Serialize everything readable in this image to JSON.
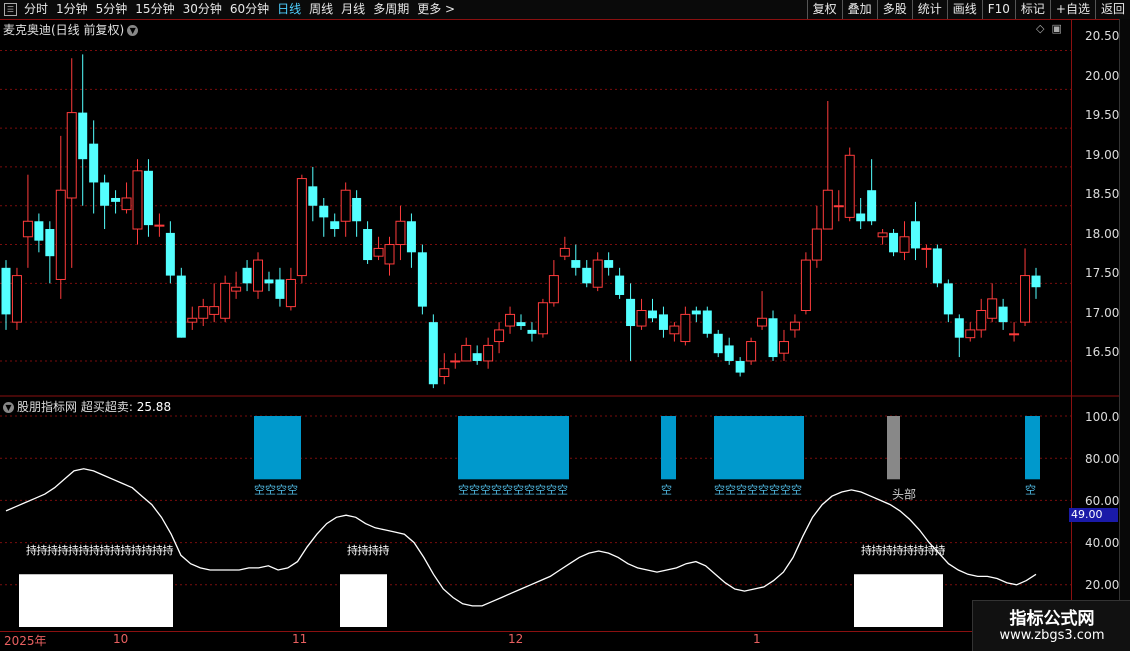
{
  "toolbar": {
    "periods": [
      "分时",
      "1分钟",
      "5分钟",
      "15分钟",
      "30分钟",
      "60分钟",
      "日线",
      "周线",
      "月线",
      "多周期",
      "更多 >"
    ],
    "active_period": "日线",
    "tools": [
      "复权",
      "叠加",
      "多股",
      "统计",
      "画线",
      "F10",
      "标记",
      "+自选",
      "返回"
    ]
  },
  "main_panel": {
    "title": "麦克奥迪(日线 前复权)",
    "price_axis": [
      "20.50",
      "20.00",
      "19.50",
      "19.00",
      "18.50",
      "18.00",
      "17.50",
      "17.00",
      "16.50"
    ]
  },
  "indicator_panel": {
    "name": "股朋指标网",
    "series_label": "超买超卖:",
    "series_value": "25.88",
    "axis": [
      "100.0",
      "80.00",
      "60.00",
      "40.00",
      "20.00"
    ],
    "current_tag": "49.00",
    "kong_label": "空",
    "chi_label": "持",
    "head_label": "头部"
  },
  "date_axis": [
    "2025年",
    "10",
    "11",
    "12",
    "1"
  ],
  "watermark": {
    "line1": "指标公式网",
    "line2": "www.zbgs3.com"
  },
  "colors": {
    "up": "#ff3c3c",
    "down": "#54ffff",
    "grid": "#7a0d0d",
    "bear_block": "#0099cc",
    "head_block": "#888888",
    "oscillator": "#ffffff"
  },
  "chart_data": {
    "type": "candlestick",
    "ylim": [
      16.1,
      20.7
    ],
    "candles": [
      [
        17.7,
        17.1,
        17.8,
        16.9
      ],
      [
        17.0,
        17.6,
        17.7,
        16.9
      ],
      [
        18.1,
        18.3,
        18.9,
        17.7
      ],
      [
        18.3,
        18.05,
        18.4,
        17.9
      ],
      [
        18.2,
        17.85,
        18.3,
        17.5
      ],
      [
        17.55,
        18.7,
        19.4,
        17.3
      ],
      [
        18.6,
        19.7,
        20.4,
        17.7
      ],
      [
        19.7,
        19.1,
        20.45,
        18.5
      ],
      [
        19.3,
        18.8,
        19.6,
        18.4
      ],
      [
        18.8,
        18.5,
        18.9,
        18.2
      ],
      [
        18.6,
        18.55,
        18.7,
        18.4
      ],
      [
        18.45,
        18.6,
        18.8,
        18.4
      ],
      [
        18.2,
        18.95,
        19.1,
        18.0
      ],
      [
        18.95,
        18.25,
        19.1,
        18.1
      ],
      [
        18.25,
        18.25,
        18.4,
        18.1
      ],
      [
        18.15,
        17.6,
        18.3,
        17.5
      ],
      [
        17.6,
        16.8,
        17.7,
        16.8
      ],
      [
        17.0,
        17.05,
        17.2,
        16.9
      ],
      [
        17.05,
        17.2,
        17.3,
        16.95
      ],
      [
        17.1,
        17.2,
        17.5,
        17.0
      ],
      [
        17.05,
        17.5,
        17.6,
        17.0
      ],
      [
        17.4,
        17.45,
        17.65,
        17.3
      ],
      [
        17.7,
        17.5,
        17.8,
        17.4
      ],
      [
        17.4,
        17.8,
        17.9,
        17.3
      ],
      [
        17.55,
        17.5,
        17.65,
        17.4
      ],
      [
        17.55,
        17.3,
        17.7,
        17.2
      ],
      [
        17.2,
        17.55,
        17.7,
        17.15
      ],
      [
        17.6,
        18.85,
        18.9,
        17.5
      ],
      [
        18.75,
        18.5,
        19.0,
        18.3
      ],
      [
        18.5,
        18.35,
        18.6,
        18.1
      ],
      [
        18.3,
        18.2,
        18.4,
        18.1
      ],
      [
        18.3,
        18.7,
        18.8,
        18.1
      ],
      [
        18.6,
        18.3,
        18.7,
        18.1
      ],
      [
        18.2,
        17.8,
        18.3,
        17.75
      ],
      [
        17.85,
        17.95,
        18.1,
        17.8
      ],
      [
        17.75,
        18.0,
        18.1,
        17.6
      ],
      [
        18.0,
        18.3,
        18.5,
        17.8
      ],
      [
        18.3,
        17.9,
        18.4,
        17.7
      ],
      [
        17.9,
        17.2,
        18.0,
        17.1
      ],
      [
        17.0,
        16.2,
        17.1,
        16.15
      ],
      [
        16.3,
        16.4,
        16.6,
        16.2
      ],
      [
        16.5,
        16.5,
        16.6,
        16.4
      ],
      [
        16.5,
        16.7,
        16.8,
        16.5
      ],
      [
        16.6,
        16.5,
        16.7,
        16.45
      ],
      [
        16.5,
        16.7,
        16.8,
        16.4
      ],
      [
        16.75,
        16.9,
        17.0,
        16.6
      ],
      [
        16.95,
        17.1,
        17.2,
        16.85
      ],
      [
        17.0,
        16.95,
        17.1,
        16.9
      ],
      [
        16.9,
        16.85,
        17.0,
        16.75
      ],
      [
        16.85,
        17.25,
        17.3,
        16.8
      ],
      [
        17.25,
        17.6,
        17.8,
        17.2
      ],
      [
        17.85,
        17.95,
        18.1,
        17.8
      ],
      [
        17.8,
        17.7,
        18.0,
        17.6
      ],
      [
        17.7,
        17.5,
        17.8,
        17.45
      ],
      [
        17.45,
        17.8,
        17.9,
        17.4
      ],
      [
        17.8,
        17.7,
        17.9,
        17.6
      ],
      [
        17.6,
        17.35,
        17.7,
        17.3
      ],
      [
        17.3,
        16.95,
        17.5,
        16.5
      ],
      [
        16.95,
        17.15,
        17.3,
        16.9
      ],
      [
        17.15,
        17.05,
        17.3,
        17.0
      ],
      [
        17.1,
        16.9,
        17.2,
        16.8
      ],
      [
        16.85,
        16.95,
        17.0,
        16.75
      ],
      [
        16.75,
        17.1,
        17.2,
        16.7
      ],
      [
        17.15,
        17.1,
        17.2,
        17.0
      ],
      [
        17.15,
        16.85,
        17.2,
        16.8
      ],
      [
        16.85,
        16.6,
        16.9,
        16.55
      ],
      [
        16.7,
        16.5,
        16.8,
        16.45
      ],
      [
        16.5,
        16.35,
        16.55,
        16.3
      ],
      [
        16.5,
        16.75,
        16.8,
        16.45
      ],
      [
        16.95,
        17.05,
        17.4,
        16.9
      ],
      [
        17.05,
        16.55,
        17.15,
        16.5
      ],
      [
        16.6,
        16.75,
        16.9,
        16.5
      ],
      [
        16.9,
        17.0,
        17.1,
        16.8
      ],
      [
        17.15,
        17.8,
        17.9,
        17.1
      ],
      [
        17.8,
        18.2,
        18.5,
        17.7
      ],
      [
        18.2,
        18.7,
        19.85,
        18.2
      ],
      [
        18.5,
        18.5,
        18.7,
        18.3
      ],
      [
        18.35,
        19.15,
        19.25,
        18.3
      ],
      [
        18.4,
        18.3,
        18.6,
        18.2
      ],
      [
        18.7,
        18.3,
        19.1,
        18.25
      ],
      [
        18.1,
        18.15,
        18.2,
        18.0
      ],
      [
        18.15,
        17.9,
        18.2,
        17.85
      ],
      [
        17.9,
        18.1,
        18.3,
        17.8
      ],
      [
        18.3,
        17.95,
        18.55,
        17.8
      ],
      [
        17.95,
        17.95,
        18.0,
        17.7
      ],
      [
        17.95,
        17.5,
        18.0,
        17.45
      ],
      [
        17.5,
        17.1,
        17.55,
        17.0
      ],
      [
        17.05,
        16.8,
        17.1,
        16.55
      ],
      [
        16.8,
        16.9,
        17.0,
        16.75
      ],
      [
        16.9,
        17.15,
        17.3,
        16.8
      ],
      [
        17.05,
        17.3,
        17.5,
        17.0
      ],
      [
        17.2,
        17.0,
        17.3,
        16.9
      ],
      [
        16.85,
        16.85,
        17.0,
        16.75
      ],
      [
        17.0,
        17.6,
        17.95,
        16.95
      ],
      [
        17.6,
        17.45,
        17.7,
        17.3
      ]
    ],
    "indicator": {
      "name": "超买超卖",
      "ylim": [
        0,
        110
      ],
      "values": [
        55,
        57,
        59,
        61,
        63,
        66,
        70,
        74,
        75,
        74,
        72,
        70,
        68,
        66,
        62,
        58,
        52,
        44,
        34,
        30,
        28,
        27,
        27,
        27,
        27,
        28,
        28,
        29,
        27,
        28,
        31,
        38,
        44,
        49,
        52,
        53,
        52,
        49,
        47,
        46,
        45,
        44,
        40,
        33,
        25,
        18,
        14,
        11,
        10,
        10,
        12,
        14,
        16,
        18,
        20,
        22,
        24,
        27,
        30,
        33,
        35,
        36,
        35,
        33,
        30,
        28,
        27,
        26,
        27,
        28,
        30,
        31,
        29,
        25,
        21,
        18,
        17,
        18,
        19,
        22,
        26,
        33,
        43,
        52,
        58,
        62,
        64,
        65,
        64,
        62,
        60,
        58,
        55,
        51,
        46,
        40,
        35,
        30,
        27,
        25,
        24,
        24,
        23,
        21,
        20,
        22,
        25
      ],
      "bear_blocks": [
        [
          254,
          301
        ],
        [
          458,
          569
        ],
        [
          661,
          676
        ],
        [
          714,
          804
        ],
        [
          1025,
          1040
        ]
      ],
      "head_block": [
        887,
        900
      ],
      "hold_blocks": [
        [
          19,
          173
        ],
        [
          340,
          387
        ],
        [
          854,
          943
        ]
      ]
    }
  }
}
